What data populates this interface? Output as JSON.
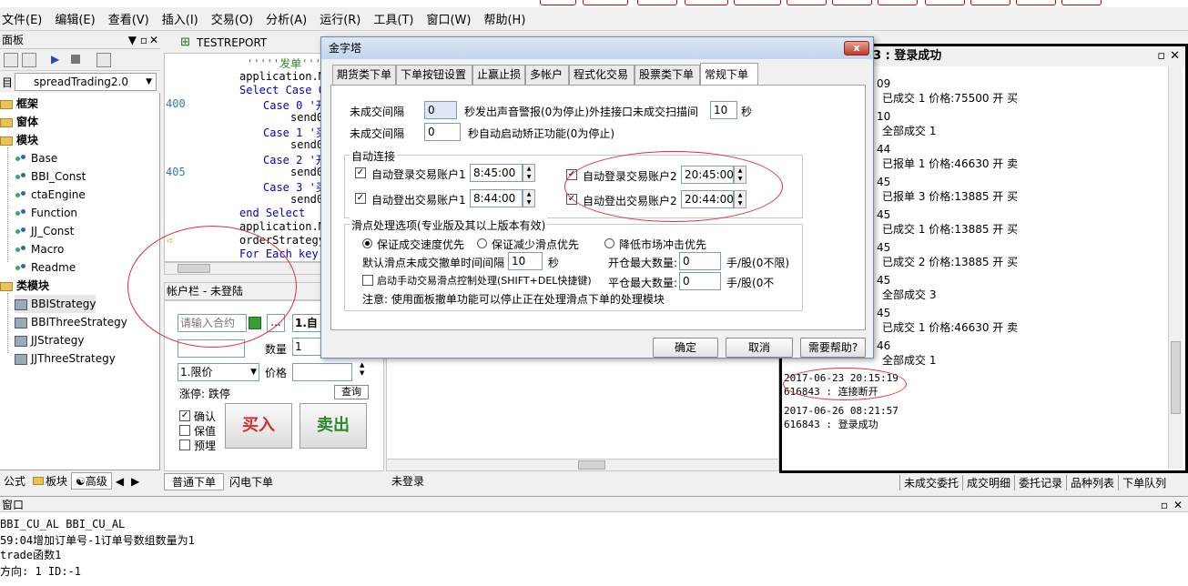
{
  "menubar": {
    "items": [
      "文件(E)",
      "编辑(E)",
      "查看(V)",
      "插入(I)",
      "交易(O)",
      "分析(A)",
      "运行(R)",
      "工具(T)",
      "窗口(W)",
      "帮助(H)"
    ]
  },
  "left_panel": {
    "title": "面板",
    "combo_prefix": "目",
    "combo_value": "spreadTrading2.0",
    "tree": {
      "framework": "框架",
      "window": "窗体",
      "modules": "模块",
      "module_items": [
        "Base",
        "BBI_Const",
        "ctaEngine",
        "Function",
        "JJ_Const",
        "Macro",
        "Readme"
      ],
      "class_modules": "类模块",
      "class_items": [
        "BBIStrategy",
        "BBIThreeStrategy",
        "JJStrategy",
        "JJThreeStrategy"
      ]
    },
    "tabs": [
      "公式",
      "板块",
      "高级"
    ]
  },
  "editor": {
    "tab": "TESTREPORT",
    "line_numbers": [
      "400",
      "405"
    ],
    "lines": [
      "'''''发单'''''",
      "application.M",
      "Select Case 0",
      "Case 0 '开",
      "send0",
      "Case 1 '买",
      "send0",
      "Case 2 '开",
      "send0",
      "Case 3 '买",
      "send0",
      "end Select",
      "application.M",
      "orderStrategy",
      "For Each key"
    ]
  },
  "account": {
    "title": "帐户栏 - 未登陆",
    "contract_placeholder": "请输入合约",
    "more_btn": "...",
    "combo1_value": "1.自",
    "qty_label": "数量",
    "qty_value": "1",
    "price_type": "1.限价",
    "price_label": "价格",
    "limit_label": "涨停: 跌停",
    "query_btn": "查询",
    "confirm": "确认",
    "keep_price": "保值",
    "pre_order": "预埋",
    "buy": "买入",
    "sell": "卖出",
    "tabs": [
      "普通下单",
      "闪电下单"
    ]
  },
  "mid": {
    "status": "未登录"
  },
  "right_panel": {
    "title": "3 : 登录成功",
    "entries": [
      {
        "head": "09",
        "text": "已成交 1 价格:75500 开 买"
      },
      {
        "head": "10",
        "text": "全部成交 1"
      },
      {
        "head": "44",
        "text": "已报单 1 价格:46630 开 卖"
      },
      {
        "head": "45",
        "text": "已报单 3 价格:13885 开 买"
      },
      {
        "head": "45",
        "text": "已成交 1 价格:13885 开 买"
      },
      {
        "head": "45",
        "text": "已成交 2 价格:13885 开 买"
      },
      {
        "head": "45",
        "text": "全部成交 3"
      },
      {
        "head": "45",
        "text": "已成交 1 价格:46630 开 卖"
      },
      {
        "head": "46",
        "text": "全部成交 1"
      }
    ],
    "ts1": "2017-06-23 20:15:19",
    "msg1": "616843 : 连接断开",
    "ts2": "2017-06-26 08:21:57",
    "msg2": "616843 : 登录成功",
    "tabs": [
      "未成交委托",
      "成交明细",
      "委托记录",
      "品种列表",
      "下单队列"
    ]
  },
  "output": {
    "title": "窗口",
    "lines": [
      "BBI_CU_AL BBI_CU_AL",
      "59:04增加订单号-1订单号数组数量为1",
      "trade函数1",
      "方向: 1  ID:-1"
    ]
  },
  "dialog": {
    "title": "金字塔",
    "close": "x",
    "tabs": [
      "期货类下单",
      "下单按钮设置",
      "止赢止损",
      "多帐户",
      "程式化交易",
      "股票类下单",
      "常规下单"
    ],
    "row1_label": "未成交间隔",
    "row1_value": "0",
    "row1_text": "秒发出声音警报(0为停止)外挂接口未成交扫描间",
    "row1_value2": "10",
    "row1_unit": "秒",
    "row2_label": "未成交间隔",
    "row2_value": "0",
    "row2_text": "秒自动启动矫正功能(0为停止)",
    "auto_group": "自动连接",
    "login1_label": "自动登录交易账户1",
    "login1_time": "8:45:00",
    "logout1_label": "自动登出交易账户1",
    "logout1_time": "8:44:00",
    "login2_label": "自动登录交易账户2",
    "login2_time": "20:45:00",
    "logout2_label": "自动登出交易账户2",
    "logout2_time": "20:44:00",
    "slip_group": "滑点处理选项(专业版及其以上版本有效)",
    "opt1": "保证成交速度优先",
    "opt2": "保证减少滑点优先",
    "opt3": "降低市场冲击优先",
    "cancel_label": "默认滑点未成交撤单时间间隔",
    "cancel_value": "10",
    "cancel_unit": "秒",
    "open_max_label": "开仓最大数量:",
    "open_max_value": "0",
    "open_max_unit": "手/股(0不限)",
    "manual_label": "启动手动交易滑点控制处理(SHIFT+DEL快捷键)",
    "close_max_label": "平仓最大数量:",
    "close_max_value": "0",
    "close_max_unit": "手/股(0不",
    "note": "注意: 使用面板撤单功能可以停止正在处理滑点下单的处理模块",
    "ok": "确定",
    "cancel": "取消",
    "help": "需要帮助?"
  }
}
